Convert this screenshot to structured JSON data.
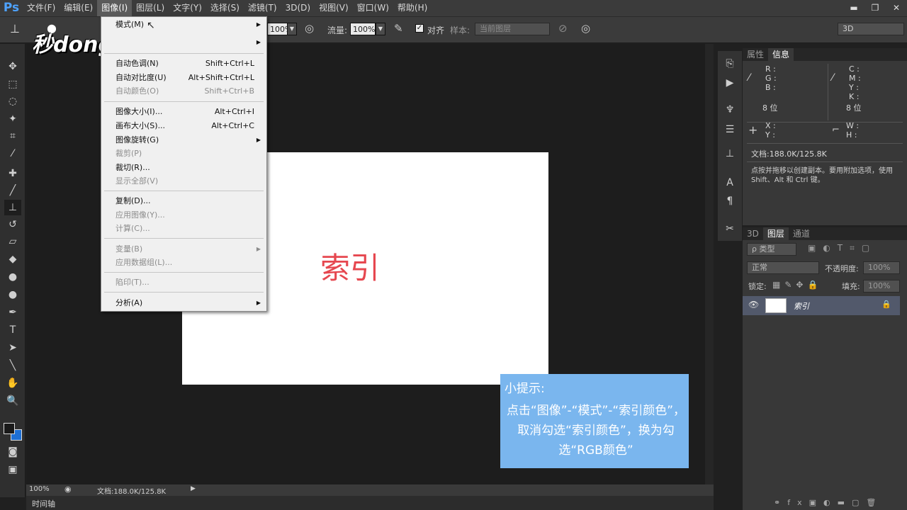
{
  "menubar": {
    "logo": "Ps",
    "items": [
      "文件(F)",
      "编辑(E)",
      "图像(I)",
      "图层(L)",
      "文字(Y)",
      "选择(S)",
      "滤镜(T)",
      "3D(D)",
      "视图(V)",
      "窗口(W)",
      "帮助(H)"
    ],
    "window_buttons": [
      "▬",
      "❐",
      "✕"
    ]
  },
  "options": {
    "opacity_value": "100%",
    "flow_label": "流量:",
    "flow_value": "100%",
    "align_label": "对齐",
    "sample_label": "样本:",
    "sample_value": "当前图层",
    "workspace": "3D"
  },
  "watermark": "秒dong视频",
  "image_menu": {
    "items": [
      {
        "label": "模式(M)",
        "shortcut": "",
        "submenu": true,
        "disabled": false
      },
      {
        "label": "",
        "shortcut": "",
        "submenu": true,
        "disabled": false
      },
      {
        "label": "自动色调(N)",
        "shortcut": "Shift+Ctrl+L",
        "submenu": false,
        "disabled": false
      },
      {
        "label": "自动对比度(U)",
        "shortcut": "Alt+Shift+Ctrl+L",
        "submenu": false,
        "disabled": false
      },
      {
        "label": "自动颜色(O)",
        "shortcut": "Shift+Ctrl+B",
        "submenu": false,
        "disabled": true
      },
      {
        "label": "图像大小(I)...",
        "shortcut": "Alt+Ctrl+I",
        "submenu": false,
        "disabled": false
      },
      {
        "label": "画布大小(S)...",
        "shortcut": "Alt+Ctrl+C",
        "submenu": false,
        "disabled": false
      },
      {
        "label": "图像旋转(G)",
        "shortcut": "",
        "submenu": true,
        "disabled": false
      },
      {
        "label": "裁剪(P)",
        "shortcut": "",
        "submenu": false,
        "disabled": true
      },
      {
        "label": "裁切(R)...",
        "shortcut": "",
        "submenu": false,
        "disabled": false
      },
      {
        "label": "显示全部(V)",
        "shortcut": "",
        "submenu": false,
        "disabled": true
      },
      {
        "label": "复制(D)...",
        "shortcut": "",
        "submenu": false,
        "disabled": false
      },
      {
        "label": "应用图像(Y)...",
        "shortcut": "",
        "submenu": false,
        "disabled": true
      },
      {
        "label": "计算(C)...",
        "shortcut": "",
        "submenu": false,
        "disabled": true
      },
      {
        "label": "变量(B)",
        "shortcut": "",
        "submenu": true,
        "disabled": true
      },
      {
        "label": "应用数据组(L)...",
        "shortcut": "",
        "submenu": false,
        "disabled": true
      },
      {
        "label": "陷印(T)...",
        "shortcut": "",
        "submenu": false,
        "disabled": true
      },
      {
        "label": "分析(A)",
        "shortcut": "",
        "submenu": true,
        "disabled": false
      }
    ]
  },
  "canvas": {
    "text": "索引"
  },
  "tip": {
    "title": "小提示:",
    "body": "点击“图像”-“模式”-“索引颜色”，取消勾选“索引颜色”，换为勾选“RGB颜色”"
  },
  "status": {
    "zoom": "100%",
    "doc": "文档:188.0K/125.8K"
  },
  "timeline": {
    "label": "时间轴"
  },
  "info_panel": {
    "tabs": [
      "属性",
      "信息"
    ],
    "rgb": "R :\nG :\nB :",
    "cmyk": "C :\nM :\nY :\nK :",
    "bits_left": "8 位",
    "bits_right": "8 位",
    "xy": "X :\nY :",
    "wh": "W :\nH :",
    "doc": "文档:188.0K/125.8K",
    "hint": "点按并拖移以创建副本。要用附加选项，使用 Shift、Alt 和 Ctrl 键。"
  },
  "layers_panel": {
    "tabs": [
      "3D",
      "图层",
      "通道"
    ],
    "kind": "ρ 类型",
    "blend": "正常",
    "opacity_label": "不透明度:",
    "opacity_value": "100%",
    "lock_label": "锁定:",
    "fill_label": "填充:",
    "fill_value": "100%",
    "layer_name": "索引"
  }
}
